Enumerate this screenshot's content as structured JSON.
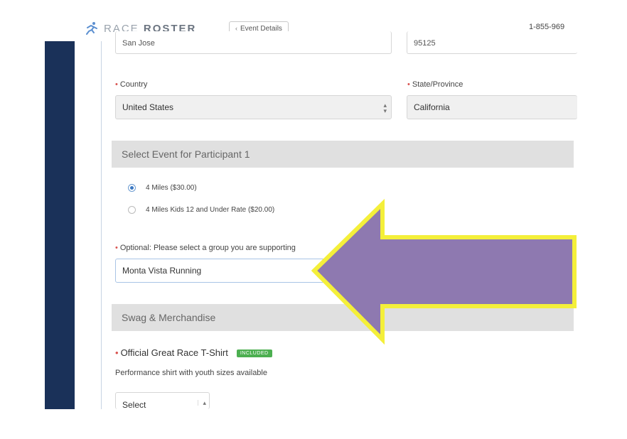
{
  "header": {
    "logo_light": "RACE",
    "logo_bold": "ROSTER",
    "back_label": "Event Details",
    "phone": "1-855-969"
  },
  "address": {
    "city_value": "San Jose",
    "zip_value": "95125"
  },
  "country": {
    "label": "Country",
    "value": "United States"
  },
  "state": {
    "label": "State/Province",
    "value": "California"
  },
  "event_section": {
    "title": "Select Event for Participant 1",
    "options": [
      {
        "label": "4 Miles ($30.00)",
        "selected": true
      },
      {
        "label": "4 Miles Kids 12 and Under Rate ($20.00)",
        "selected": false
      }
    ]
  },
  "group": {
    "label": "Optional: Please select a group you are supporting",
    "value": "Monta Vista Running"
  },
  "swag_section": {
    "title": "Swag & Merchandise"
  },
  "tshirt": {
    "label": "Official Great Race T-Shirt",
    "badge": "INCLUDED",
    "description": "Performance shirt with youth sizes available",
    "select_value": "Select"
  },
  "colors": {
    "sidebar": "#1a3159",
    "arrow_fill": "#8e79b0",
    "arrow_stroke": "#f4ef3a",
    "badge": "#4caf50"
  }
}
